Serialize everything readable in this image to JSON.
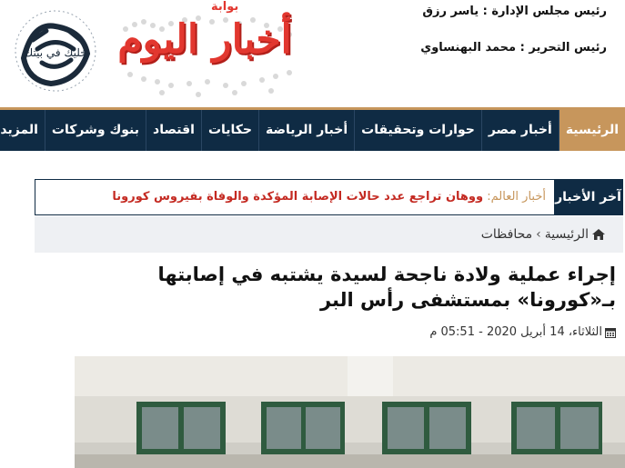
{
  "header": {
    "board_chair": "رئيس مجلس الإدارة : ياسر رزق",
    "editor_in_chief": "رئيس التحرير : محمد البهنساوي",
    "logo_text": "أخبار اليوم",
    "logo_small": "بوابة",
    "calligraphy_text": "خليك في بيتك"
  },
  "nav": {
    "items": [
      {
        "label": "الرئيسية",
        "active": true
      },
      {
        "label": "أخبار مصر"
      },
      {
        "label": "حوارات وتحقيقات"
      },
      {
        "label": "أخبار الرياضة"
      },
      {
        "label": "حكايات"
      },
      {
        "label": "اقتصاد"
      },
      {
        "label": "بنوك وشركات"
      },
      {
        "label": "المزيد"
      }
    ],
    "more_icon": "chevron-down-icon",
    "colors": {
      "background": "#0f2b44",
      "accent": "#c7965c"
    }
  },
  "ticker": {
    "label": "آخر الأخبار",
    "category": "أخبار العالم:",
    "headline": "ووهان تراجع عدد حالات الإصابة المؤكدة والوفاة بفيروس كورونا",
    "headline_color": "#c42a22"
  },
  "breadcrumb": {
    "home": "الرئيسية",
    "separator": "›",
    "current": "محافظات",
    "home_icon": "home-icon"
  },
  "article": {
    "title": "إجراء عملية ولادة ناجحة لسيدة يشتبه في إصابتها بـ«كورونا» بمستشفى رأس البر",
    "date": "الثلاثاء، 14 أبريل 2020 - 05:51 م",
    "date_icon": "calendar-icon"
  }
}
